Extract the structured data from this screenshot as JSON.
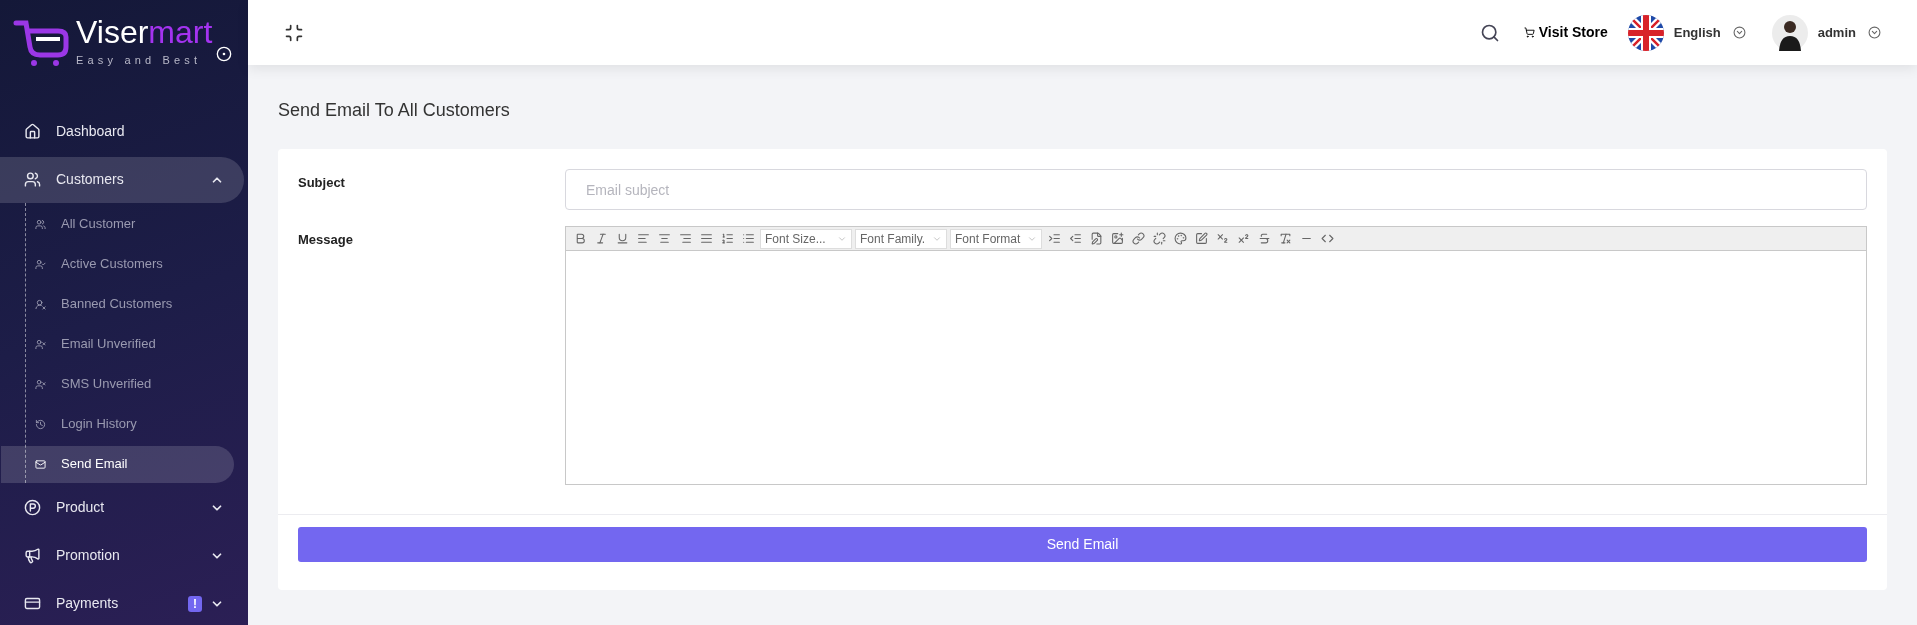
{
  "logo": {
    "name_start": "Viser",
    "name_end": "mart",
    "tagline": "Easy and Best"
  },
  "sidebar": {
    "items": [
      {
        "kind": "link",
        "label": "Dashboard",
        "selected": false
      },
      {
        "kind": "group",
        "label": "Customers",
        "expanded": true,
        "selected": true,
        "children": [
          {
            "label": "All Customer",
            "selected": false
          },
          {
            "label": "Active Customers",
            "selected": false
          },
          {
            "label": "Banned Customers",
            "selected": false
          },
          {
            "label": "Email Unverified",
            "selected": false
          },
          {
            "label": "SMS Unverified",
            "selected": false
          },
          {
            "label": "Login History",
            "selected": false
          },
          {
            "label": "Send Email",
            "selected": true
          }
        ]
      },
      {
        "kind": "group",
        "label": "Product",
        "expanded": false,
        "selected": false
      },
      {
        "kind": "group",
        "label": "Promotion",
        "expanded": false,
        "selected": false
      },
      {
        "kind": "group",
        "label": "Payments",
        "expanded": false,
        "selected": false,
        "badge": "!"
      }
    ]
  },
  "topbar": {
    "visit_store": "Visit Store",
    "language": "English",
    "user": "admin"
  },
  "page": {
    "title": "Send Email To All Customers",
    "form": {
      "subject": {
        "label": "Subject",
        "placeholder": "Email subject"
      },
      "message": {
        "label": "Message",
        "toolbar_selects": [
          "Font Size...",
          "Font Family.",
          "Font Format"
        ]
      },
      "submit": "Send Email"
    }
  }
}
